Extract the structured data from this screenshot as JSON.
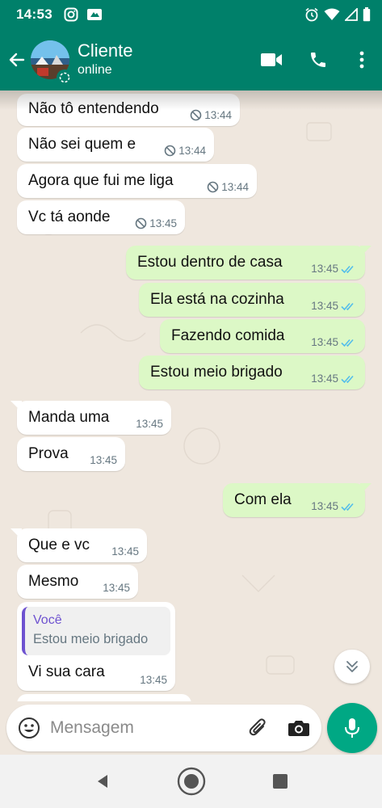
{
  "status_bar": {
    "time": "14:53",
    "icons": [
      "instagram-icon",
      "notification-icon",
      "alarm-icon",
      "wifi-icon",
      "signal-icon",
      "battery-icon"
    ]
  },
  "header": {
    "contact_name": "Cliente",
    "contact_status": "online",
    "icons": [
      "back-arrow-icon",
      "video-call-icon",
      "voice-call-icon",
      "more-options-icon"
    ]
  },
  "messages": [
    {
      "direction": "in",
      "text": "Não tô entendendo",
      "time": "13:44",
      "status": "deleted-marker"
    },
    {
      "direction": "in",
      "text": "Não sei quem e",
      "time": "13:44",
      "status": "deleted-marker"
    },
    {
      "direction": "in",
      "text": "Agora que fui me liga",
      "time": "13:44",
      "status": "deleted-marker"
    },
    {
      "direction": "in",
      "text": "Vc tá aonde",
      "time": "13:45",
      "status": "deleted-marker"
    },
    {
      "direction": "out",
      "text": "Estou dentro de casa",
      "time": "13:45",
      "status": "read"
    },
    {
      "direction": "out",
      "text": "Ela está na cozinha",
      "time": "13:45",
      "status": "read"
    },
    {
      "direction": "out",
      "text": "Fazendo comida",
      "time": "13:45",
      "status": "read"
    },
    {
      "direction": "out",
      "text": "Estou meio brigado",
      "time": "13:45",
      "status": "read"
    },
    {
      "direction": "in",
      "text": "Manda uma",
      "time": "13:45"
    },
    {
      "direction": "in",
      "text": "Prova",
      "time": "13:45"
    },
    {
      "direction": "out",
      "text": "Com ela",
      "time": "13:45",
      "status": "read"
    },
    {
      "direction": "in",
      "text": "Que e vc",
      "time": "13:45"
    },
    {
      "direction": "in",
      "text": "Mesmo",
      "time": "13:45"
    },
    {
      "direction": "in",
      "text": "Vi sua cara",
      "time": "13:45",
      "quote": {
        "author": "Você",
        "text": "Estou meio brigado"
      }
    }
  ],
  "colors": {
    "header": "#00806a",
    "outgoing_bubble": "#dcf8c6",
    "incoming_bubble": "#ffffff",
    "read_ticks": "#53bdeb",
    "mic_button": "#00a884",
    "quote_accent": "#6e52d0"
  },
  "composer": {
    "placeholder": "Mensagem",
    "icons": [
      "emoji-icon",
      "attach-icon",
      "camera-icon",
      "mic-icon"
    ]
  },
  "nav_bar": {
    "icons": [
      "nav-back-icon",
      "nav-home-icon",
      "nav-recents-icon"
    ]
  }
}
